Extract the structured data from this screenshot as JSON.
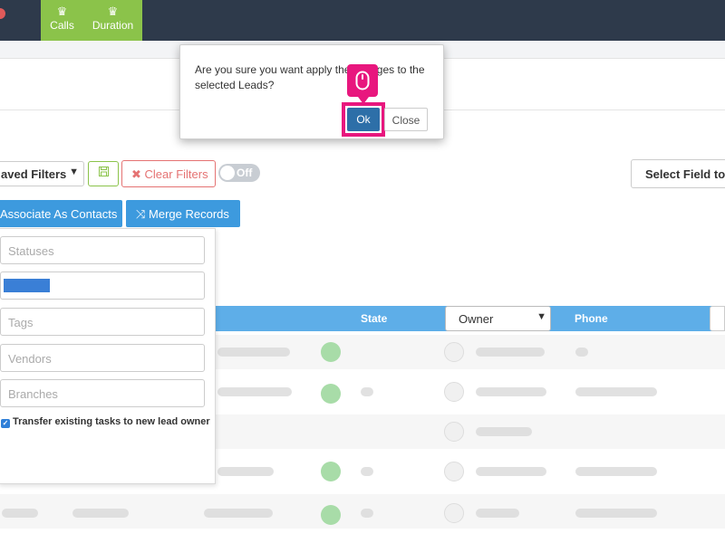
{
  "navbar": {
    "tabs": [
      {
        "label": "Calls",
        "icon": "crown-icon"
      },
      {
        "label": "Duration",
        "icon": "crown-icon"
      }
    ],
    "accent_color": "#8bc34a",
    "background_color": "#2e3a4b"
  },
  "filters": {
    "saved_filters_label": "aved Filters",
    "save_icon": "floppy-disk-icon",
    "clear_filters_label": "Clear Filters",
    "clear_icon": "times-icon",
    "toggle_label": "Off",
    "select_field_label": "Select Field to"
  },
  "actions": {
    "associate_label": "Associate As Contacts",
    "merge_label": "Merge Records",
    "merge_icon": "shuffle-icon",
    "button_color": "#3d9ade"
  },
  "table": {
    "columns": {
      "state": "State",
      "owner_select_value": "Owner",
      "phone": "Phone"
    },
    "header_color": "#5eaee8"
  },
  "panel": {
    "fields": [
      {
        "placeholder": "Statuses"
      },
      {
        "placeholder": ""
      },
      {
        "placeholder": "Tags"
      },
      {
        "placeholder": "Vendors"
      },
      {
        "placeholder": "Branches"
      }
    ],
    "checkbox_label": "Transfer existing tasks to new lead owner",
    "checkbox_checked": true
  },
  "dialog": {
    "message": "Are you sure you want apply the changes to the selected Leads?",
    "ok_label": "Ok",
    "close_label": "Close",
    "highlight_color": "#e8177e"
  }
}
